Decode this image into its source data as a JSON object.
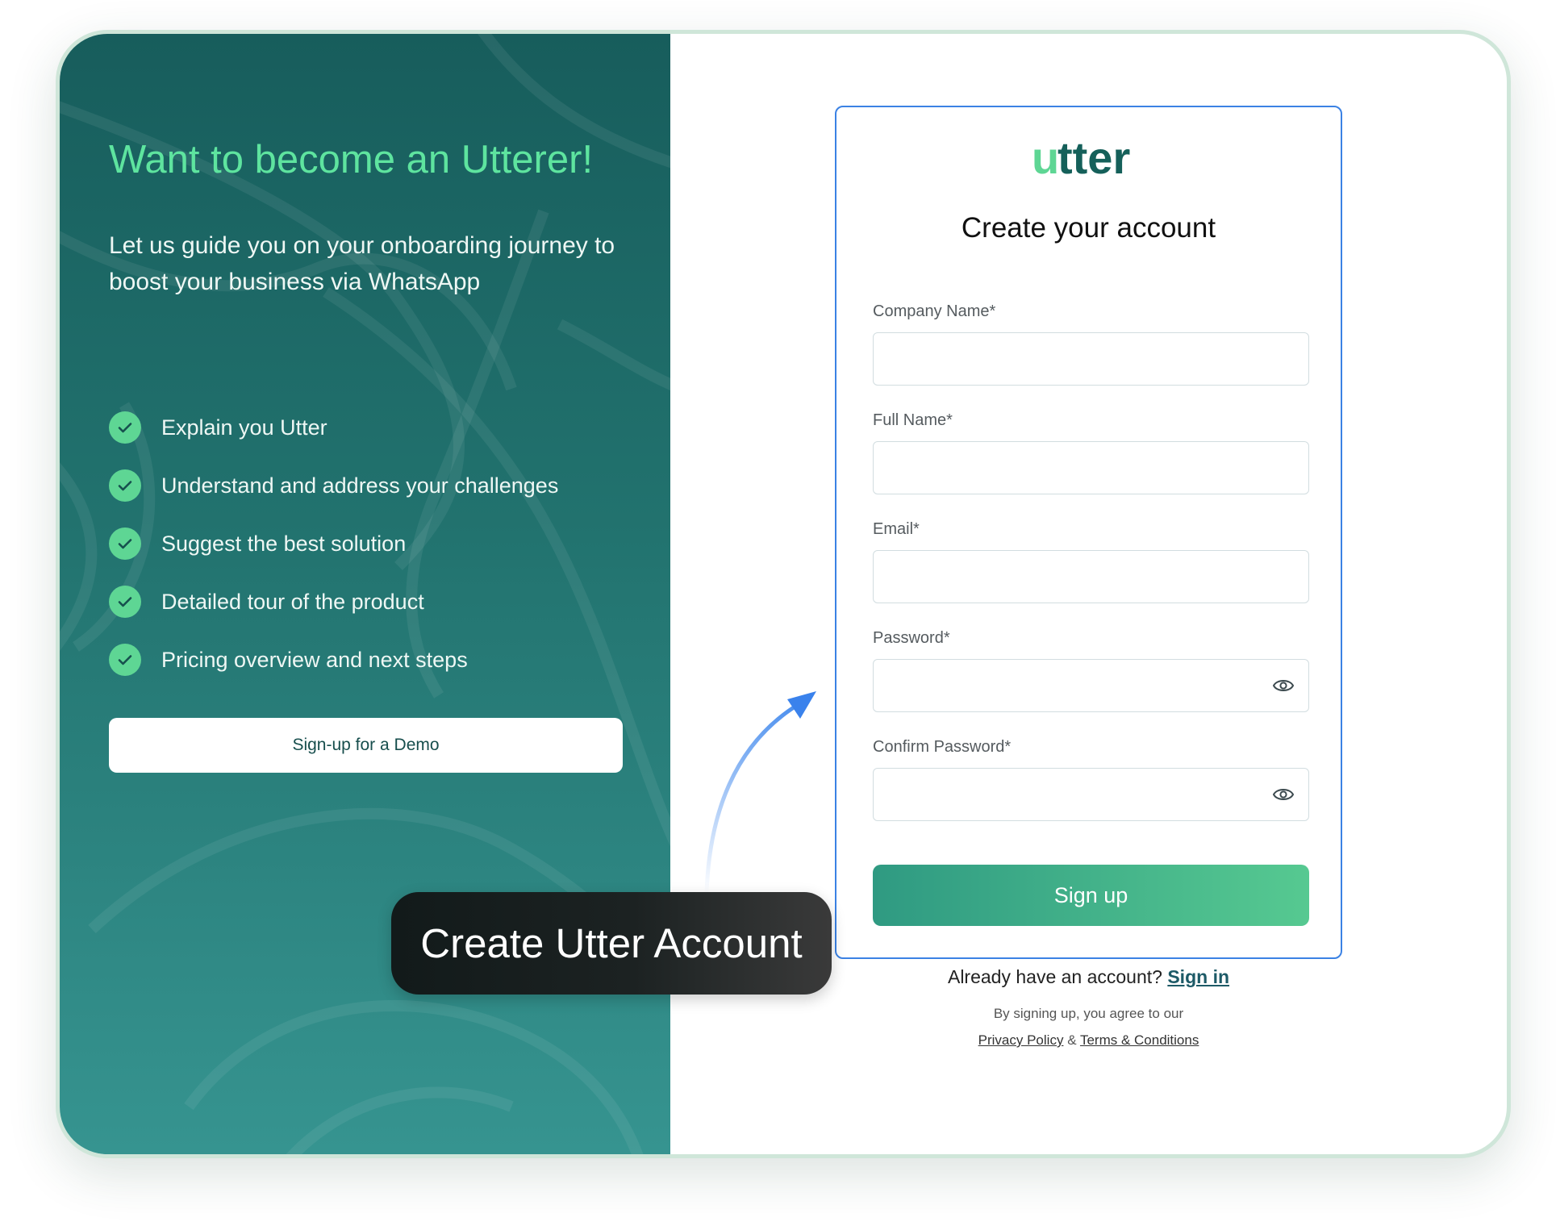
{
  "promo": {
    "title": "Want to become an Utterer!",
    "subtitle": "Let us guide you on your onboarding journey to boost your business via WhatsApp",
    "features": [
      "Explain you Utter",
      "Understand and address your challenges",
      "Suggest the best solution",
      "Detailed tour of the product",
      "Pricing overview and next steps"
    ],
    "demo_button": "Sign-up for a Demo"
  },
  "form": {
    "logo_text": "utter",
    "title": "Create your account",
    "fields": [
      {
        "label": "Company Name*",
        "value": "",
        "type": "text"
      },
      {
        "label": "Full Name*",
        "value": "",
        "type": "text"
      },
      {
        "label": "Email*",
        "value": "",
        "type": "email"
      },
      {
        "label": "Password*",
        "value": "",
        "type": "password"
      },
      {
        "label": "Confirm Password*",
        "value": "",
        "type": "password"
      }
    ],
    "submit_label": "Sign up",
    "already_text": "Already have an account?",
    "signin_link": "Sign in",
    "agree_text": "By signing up, you agree to our",
    "privacy_link": "Privacy Policy",
    "amp": "&",
    "terms_link": "Terms & Conditions"
  },
  "callout": {
    "text": "Create Utter Account"
  },
  "icons": {
    "check": "check-icon",
    "eye": "eye-icon",
    "arrow": "arrow-icon"
  },
  "colors": {
    "panel_dark": "#175d5c",
    "panel_light": "#369490",
    "accent_green": "#5ee49f",
    "button_gradient_start": "#2f9a82",
    "button_gradient_end": "#56c991",
    "card_border": "#3b82e4",
    "logo_u": "#5ed694",
    "logo_rest": "#15605a"
  }
}
